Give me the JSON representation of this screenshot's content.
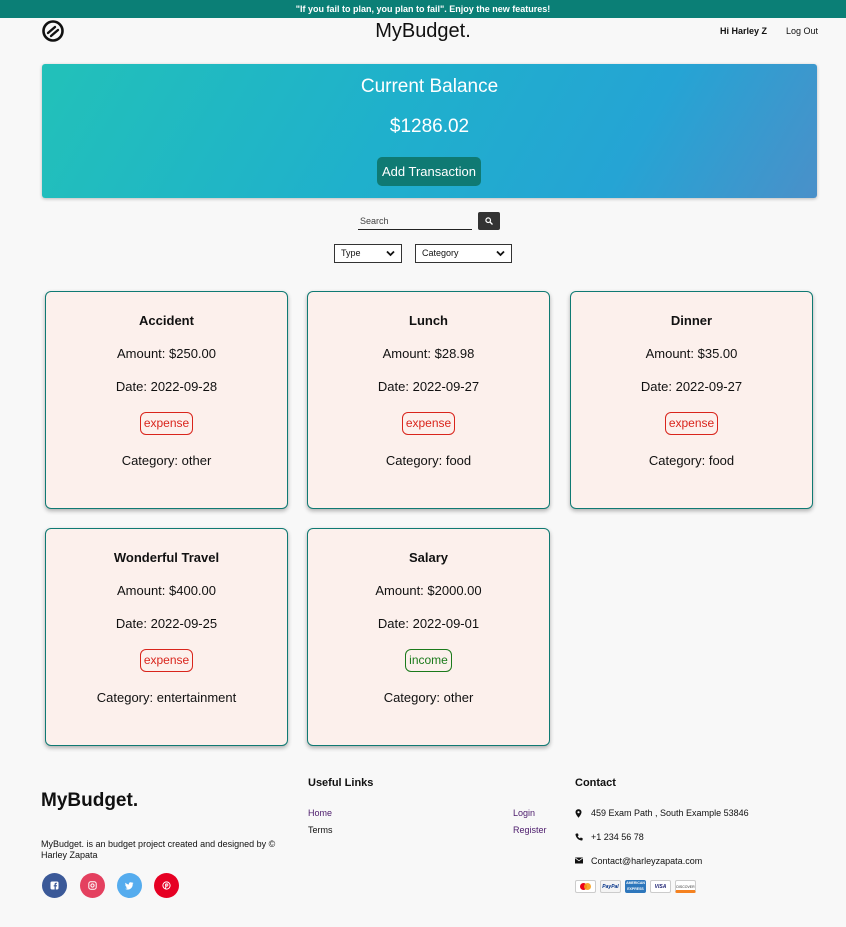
{
  "banner": {
    "text": "\"If you fail to plan, you plan to fail\". Enjoy the new features!"
  },
  "header": {
    "brand": "MyBudget.",
    "greeting": "Hi Harley Z",
    "logout": "Log Out"
  },
  "balance": {
    "title": "Current Balance",
    "amount": "$1286.02",
    "add_button": "Add Transaction"
  },
  "search": {
    "placeholder": "Search"
  },
  "filters": {
    "type": "Type",
    "category": "Category"
  },
  "transactions": [
    {
      "name": "Accident",
      "amount": "Amount: $250.00",
      "date": "Date: 2022-09-28",
      "kind": "expense",
      "category": "Category: other"
    },
    {
      "name": "Lunch",
      "amount": "Amount: $28.98",
      "date": "Date: 2022-09-27",
      "kind": "expense",
      "category": "Category: food"
    },
    {
      "name": "Dinner",
      "amount": "Amount: $35.00",
      "date": "Date: 2022-09-27",
      "kind": "expense",
      "category": "Category: food"
    },
    {
      "name": "Wonderful Travel",
      "amount": "Amount: $400.00",
      "date": "Date: 2022-09-25",
      "kind": "expense",
      "category": "Category: entertainment"
    },
    {
      "name": "Salary",
      "amount": "Amount: $2000.00",
      "date": "Date: 2022-09-01",
      "kind": "income",
      "category": "Category: other"
    }
  ],
  "footer": {
    "brand": "MyBudget.",
    "description": "MyBudget. is an budget project created and designed by © Harley Zapata",
    "social": [
      "facebook-icon",
      "instagram-icon",
      "twitter-icon",
      "pinterest-icon"
    ],
    "useful_links_title": "Useful Links",
    "links": {
      "home": "Home",
      "terms": "Terms",
      "login": "Login",
      "register": "Register"
    },
    "contact_title": "Contact",
    "address": "459 Exam Path , South Example 53846",
    "phone": "+1 234 56 78",
    "email": "Contact@harleyzapata.com",
    "payments": [
      "MasterCard",
      "PayPal",
      "AMERICAN EXPRESS",
      "VISA",
      "DISCOVER"
    ]
  },
  "colors": {
    "banner": "#0b7f76",
    "accent": "#0f7a73",
    "expense": "#d9251c",
    "income": "#1b7a1b",
    "card_bg": "#fcf0ec",
    "link": "#4b1a6b"
  }
}
